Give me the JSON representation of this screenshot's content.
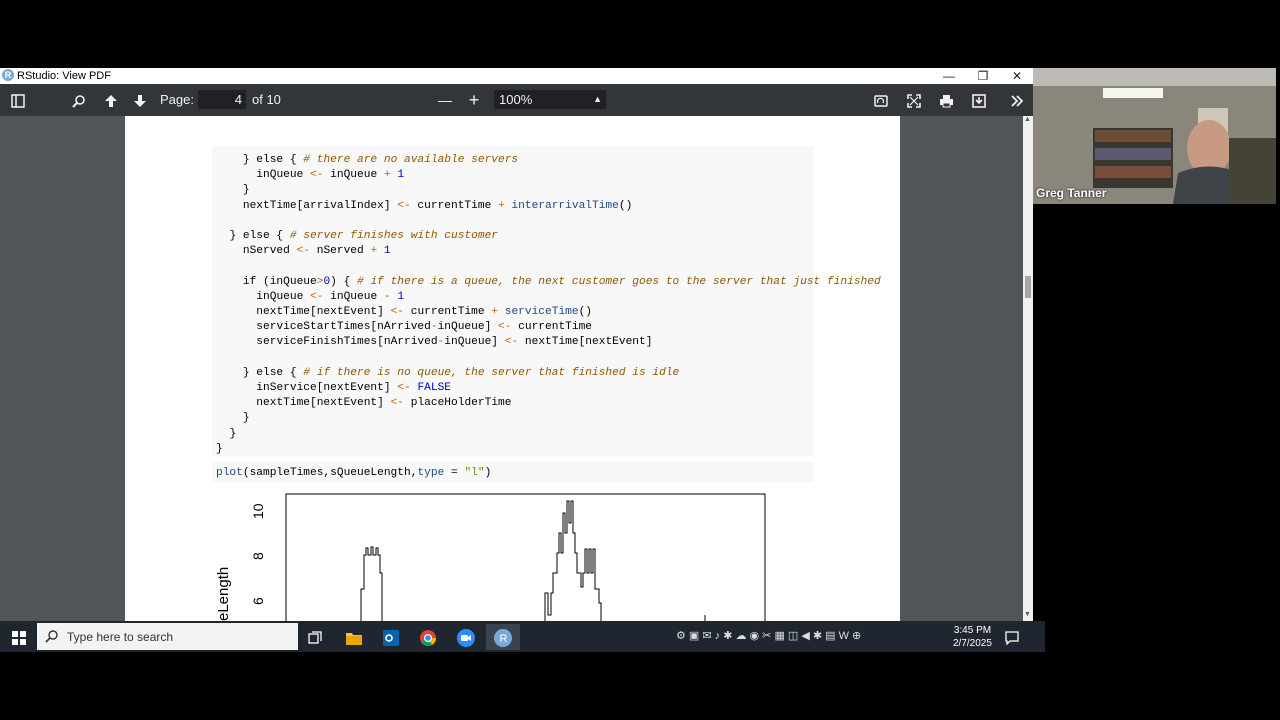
{
  "window": {
    "title": "RStudio: View PDF",
    "logo_letter": "R",
    "controls": {
      "minimize": "—",
      "restore": "❐",
      "close": "✕"
    }
  },
  "toolbar": {
    "icons": [
      "sidebar-toggle-icon",
      "search-icon",
      "page-up-icon",
      "page-down-icon",
      "zoom-out-icon",
      "zoom-in-icon",
      "rotate-icon",
      "fullscreen-icon",
      "print-icon",
      "download-icon",
      "more-tools-icon"
    ],
    "page_label": "Page:",
    "page_value": "4",
    "page_of": "of 10",
    "zoom_out": "—",
    "zoom_in": "+",
    "zoom_value": "100%"
  },
  "pdf": {
    "code_lines": [
      {
        "indent": "    ",
        "parts": [
          [
            "kw",
            "} else { "
          ],
          [
            "cm",
            "# there are no available servers"
          ]
        ]
      },
      {
        "indent": "      ",
        "parts": [
          [
            "kw",
            "inQueue "
          ],
          [
            "op",
            "<-"
          ],
          [
            "kw",
            " inQueue "
          ],
          [
            "op",
            "+"
          ],
          [
            "num",
            " 1"
          ]
        ]
      },
      {
        "indent": "    ",
        "parts": [
          [
            "kw",
            "}"
          ]
        ]
      },
      {
        "indent": "    ",
        "parts": [
          [
            "kw",
            "nextTime[arrivalIndex] "
          ],
          [
            "op",
            "<-"
          ],
          [
            "kw",
            " currentTime "
          ],
          [
            "op",
            "+"
          ],
          [
            "fn",
            " interarrivalTime"
          ],
          [
            "kw",
            "()"
          ]
        ]
      },
      {
        "indent": "",
        "parts": []
      },
      {
        "indent": "  ",
        "parts": [
          [
            "kw",
            "} else { "
          ],
          [
            "cm",
            "# server finishes with customer"
          ]
        ]
      },
      {
        "indent": "    ",
        "parts": [
          [
            "kw",
            "nServed "
          ],
          [
            "op",
            "<-"
          ],
          [
            "kw",
            " nServed "
          ],
          [
            "op",
            "+"
          ],
          [
            "num",
            " 1"
          ]
        ]
      },
      {
        "indent": "",
        "parts": []
      },
      {
        "indent": "    ",
        "parts": [
          [
            "kw",
            "if (inQueue"
          ],
          [
            "op",
            ">"
          ],
          [
            "num",
            "0"
          ],
          [
            "kw",
            ") { "
          ],
          [
            "cm",
            "# if there is a queue, the next customer goes to the server that just finished"
          ]
        ]
      },
      {
        "indent": "      ",
        "parts": [
          [
            "kw",
            "inQueue "
          ],
          [
            "op",
            "<-"
          ],
          [
            "kw",
            " inQueue "
          ],
          [
            "op",
            "-"
          ],
          [
            "num",
            " 1"
          ]
        ]
      },
      {
        "indent": "      ",
        "parts": [
          [
            "kw",
            "nextTime[nextEvent] "
          ],
          [
            "op",
            "<-"
          ],
          [
            "kw",
            " currentTime "
          ],
          [
            "op",
            "+"
          ],
          [
            "fn",
            " serviceTime"
          ],
          [
            "kw",
            "()"
          ]
        ]
      },
      {
        "indent": "      ",
        "parts": [
          [
            "kw",
            "serviceStartTimes[nArrived"
          ],
          [
            "op",
            "-"
          ],
          [
            "kw",
            "inQueue] "
          ],
          [
            "op",
            "<-"
          ],
          [
            "kw",
            " currentTime"
          ]
        ]
      },
      {
        "indent": "      ",
        "parts": [
          [
            "kw",
            "serviceFinishTimes[nArrived"
          ],
          [
            "op",
            "-"
          ],
          [
            "kw",
            "inQueue] "
          ],
          [
            "op",
            "<-"
          ],
          [
            "kw",
            " nextTime[nextEvent]"
          ]
        ]
      },
      {
        "indent": "",
        "parts": []
      },
      {
        "indent": "    ",
        "parts": [
          [
            "kw",
            "} else { "
          ],
          [
            "cm",
            "# if there is no queue, the server that finished is idle"
          ]
        ]
      },
      {
        "indent": "      ",
        "parts": [
          [
            "kw",
            "inService[nextEvent] "
          ],
          [
            "op",
            "<-"
          ],
          [
            "num",
            " FALSE"
          ]
        ]
      },
      {
        "indent": "      ",
        "parts": [
          [
            "kw",
            "nextTime[nextEvent] "
          ],
          [
            "op",
            "<-"
          ],
          [
            "kw",
            " placeHolderTime"
          ]
        ]
      },
      {
        "indent": "    ",
        "parts": [
          [
            "kw",
            "}"
          ]
        ]
      },
      {
        "indent": "  ",
        "parts": [
          [
            "kw",
            "}"
          ]
        ]
      },
      {
        "indent": "",
        "parts": [
          [
            "kw",
            "}"
          ]
        ]
      }
    ],
    "plot_call": [
      [
        "fn",
        "plot"
      ],
      [
        "kw",
        "(sampleTimes,sQueueLength,"
      ],
      [
        "fn",
        "type"
      ],
      [
        "kw",
        " = "
      ],
      [
        "str",
        "\"l\""
      ],
      [
        "kw",
        ")"
      ]
    ],
    "plot": {
      "ylabel_visible": "eLength",
      "y_ticks": [
        "10",
        "8",
        "6"
      ]
    }
  },
  "webcam": {
    "name": "Greg Tanner"
  },
  "taskbar": {
    "search_placeholder": "Type here to search",
    "apps": [
      "task-view-icon",
      "file-explorer-icon",
      "outlook-icon",
      "chrome-icon",
      "zoom-icon",
      "rstudio-icon"
    ],
    "time": "3:45 PM",
    "date": "2/7/2025"
  }
}
